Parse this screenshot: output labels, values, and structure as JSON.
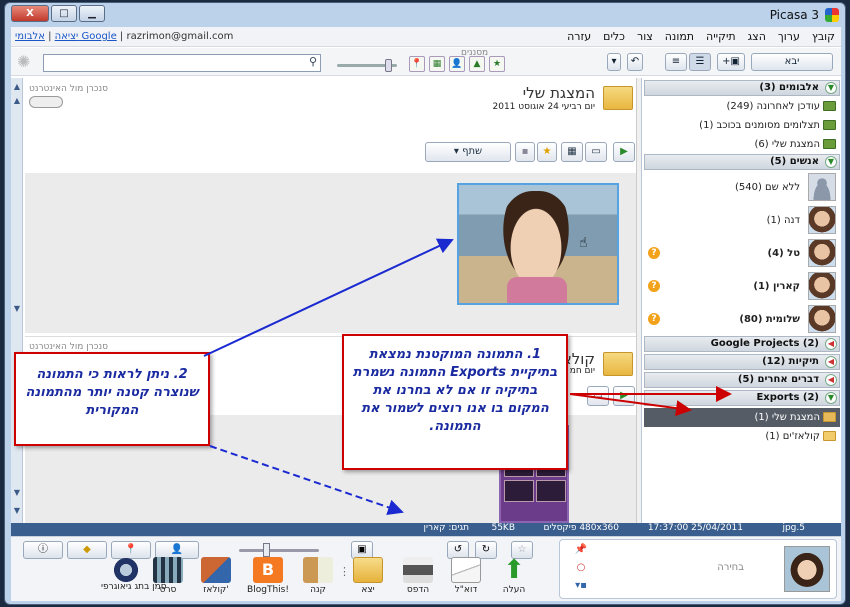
{
  "window": {
    "title": "Picasa 3",
    "controls": {
      "minimize": "▁",
      "maximize": "□",
      "close": "X"
    }
  },
  "menu": [
    "קובץ",
    "ערוך",
    "הצג",
    "תיקייה",
    "תמונה",
    "צור",
    "כלים",
    "עזרה"
  ],
  "account": {
    "signout": "יציאה",
    "albums": "אלבומי Google",
    "email": "razrimon@gmail.com"
  },
  "toolbar": {
    "import_label": "יבא",
    "filters_label": "מסננים",
    "search_placeholder": ""
  },
  "panel": {
    "sections": {
      "albums": "אלבומים (3)",
      "people": "אנשים (5)",
      "google_projects": "Google Projects (2)",
      "folders": "תיקיות (12)",
      "other": "דברים אחרים (5)",
      "exports": "Exports (2)"
    },
    "albums": [
      "עודכן לאחרונה (249)",
      "תצלומים מסומנים בכוכב (1)",
      "המצגת שלי (6)"
    ],
    "people": [
      {
        "name": "ללא שם (540)",
        "bold": false
      },
      {
        "name": "דנה (1)",
        "bold": false
      },
      {
        "name": "טל (4)",
        "bold": true
      },
      {
        "name": "קארין (1)",
        "bold": true
      },
      {
        "name": "שלומית (80)",
        "bold": true
      }
    ],
    "exports": [
      "המצגת שלי (1)",
      "קולאז'ים (1)"
    ]
  },
  "album1": {
    "title": "המצגת שלי",
    "date": "יום רביעי 24 אוגוסט 2011",
    "sync_label": "סנכרן מול האינטרנט",
    "share_label": "שתף"
  },
  "album2": {
    "title": "קולאז'ים",
    "date": "יום חמ",
    "sync_label": "סנכרן מול האינטרנט"
  },
  "infobar": {
    "file": "5.jpg",
    "datetime": "25/04/2011 17:37:00",
    "dims": "480x360 פיקסלים",
    "size": "55KB",
    "tags": "תגים: קארין"
  },
  "bottom": {
    "actions": [
      {
        "label": "העלה",
        "name": "upload"
      },
      {
        "label": "דוא\"ל",
        "name": "email"
      },
      {
        "label": "הדפס",
        "name": "print"
      },
      {
        "label": "יצא",
        "name": "export"
      }
    ],
    "creates": [
      {
        "label": "קנה",
        "name": "buy"
      },
      {
        "label": "BlogThis!",
        "name": "blogthis"
      },
      {
        "label": "קולאז'",
        "name": "collage"
      },
      {
        "label": "סרט",
        "name": "movie"
      },
      {
        "label": "סמן בתג גיאוגרפי",
        "name": "geotag"
      }
    ],
    "tray_label": "בחירה"
  },
  "callouts": {
    "c1": "1. התמונה המוקטנת נמצאת בתיקיית Exports התמונה נשמרת בתיקיה זו אם לא בחרנו את המקום בו אנו רוצים לשמור את התמונה.",
    "c2": "2. ניתן לראות כי התמונה שנוצרה קטנה יותר מהתמונה המקורית"
  },
  "colors": {
    "accent": "#3a5f8e",
    "callout_border": "#cc0000",
    "callout_text": "#1a2aa0",
    "arrow_blue": "#1a2ad0",
    "arrow_red": "#cc0000"
  }
}
